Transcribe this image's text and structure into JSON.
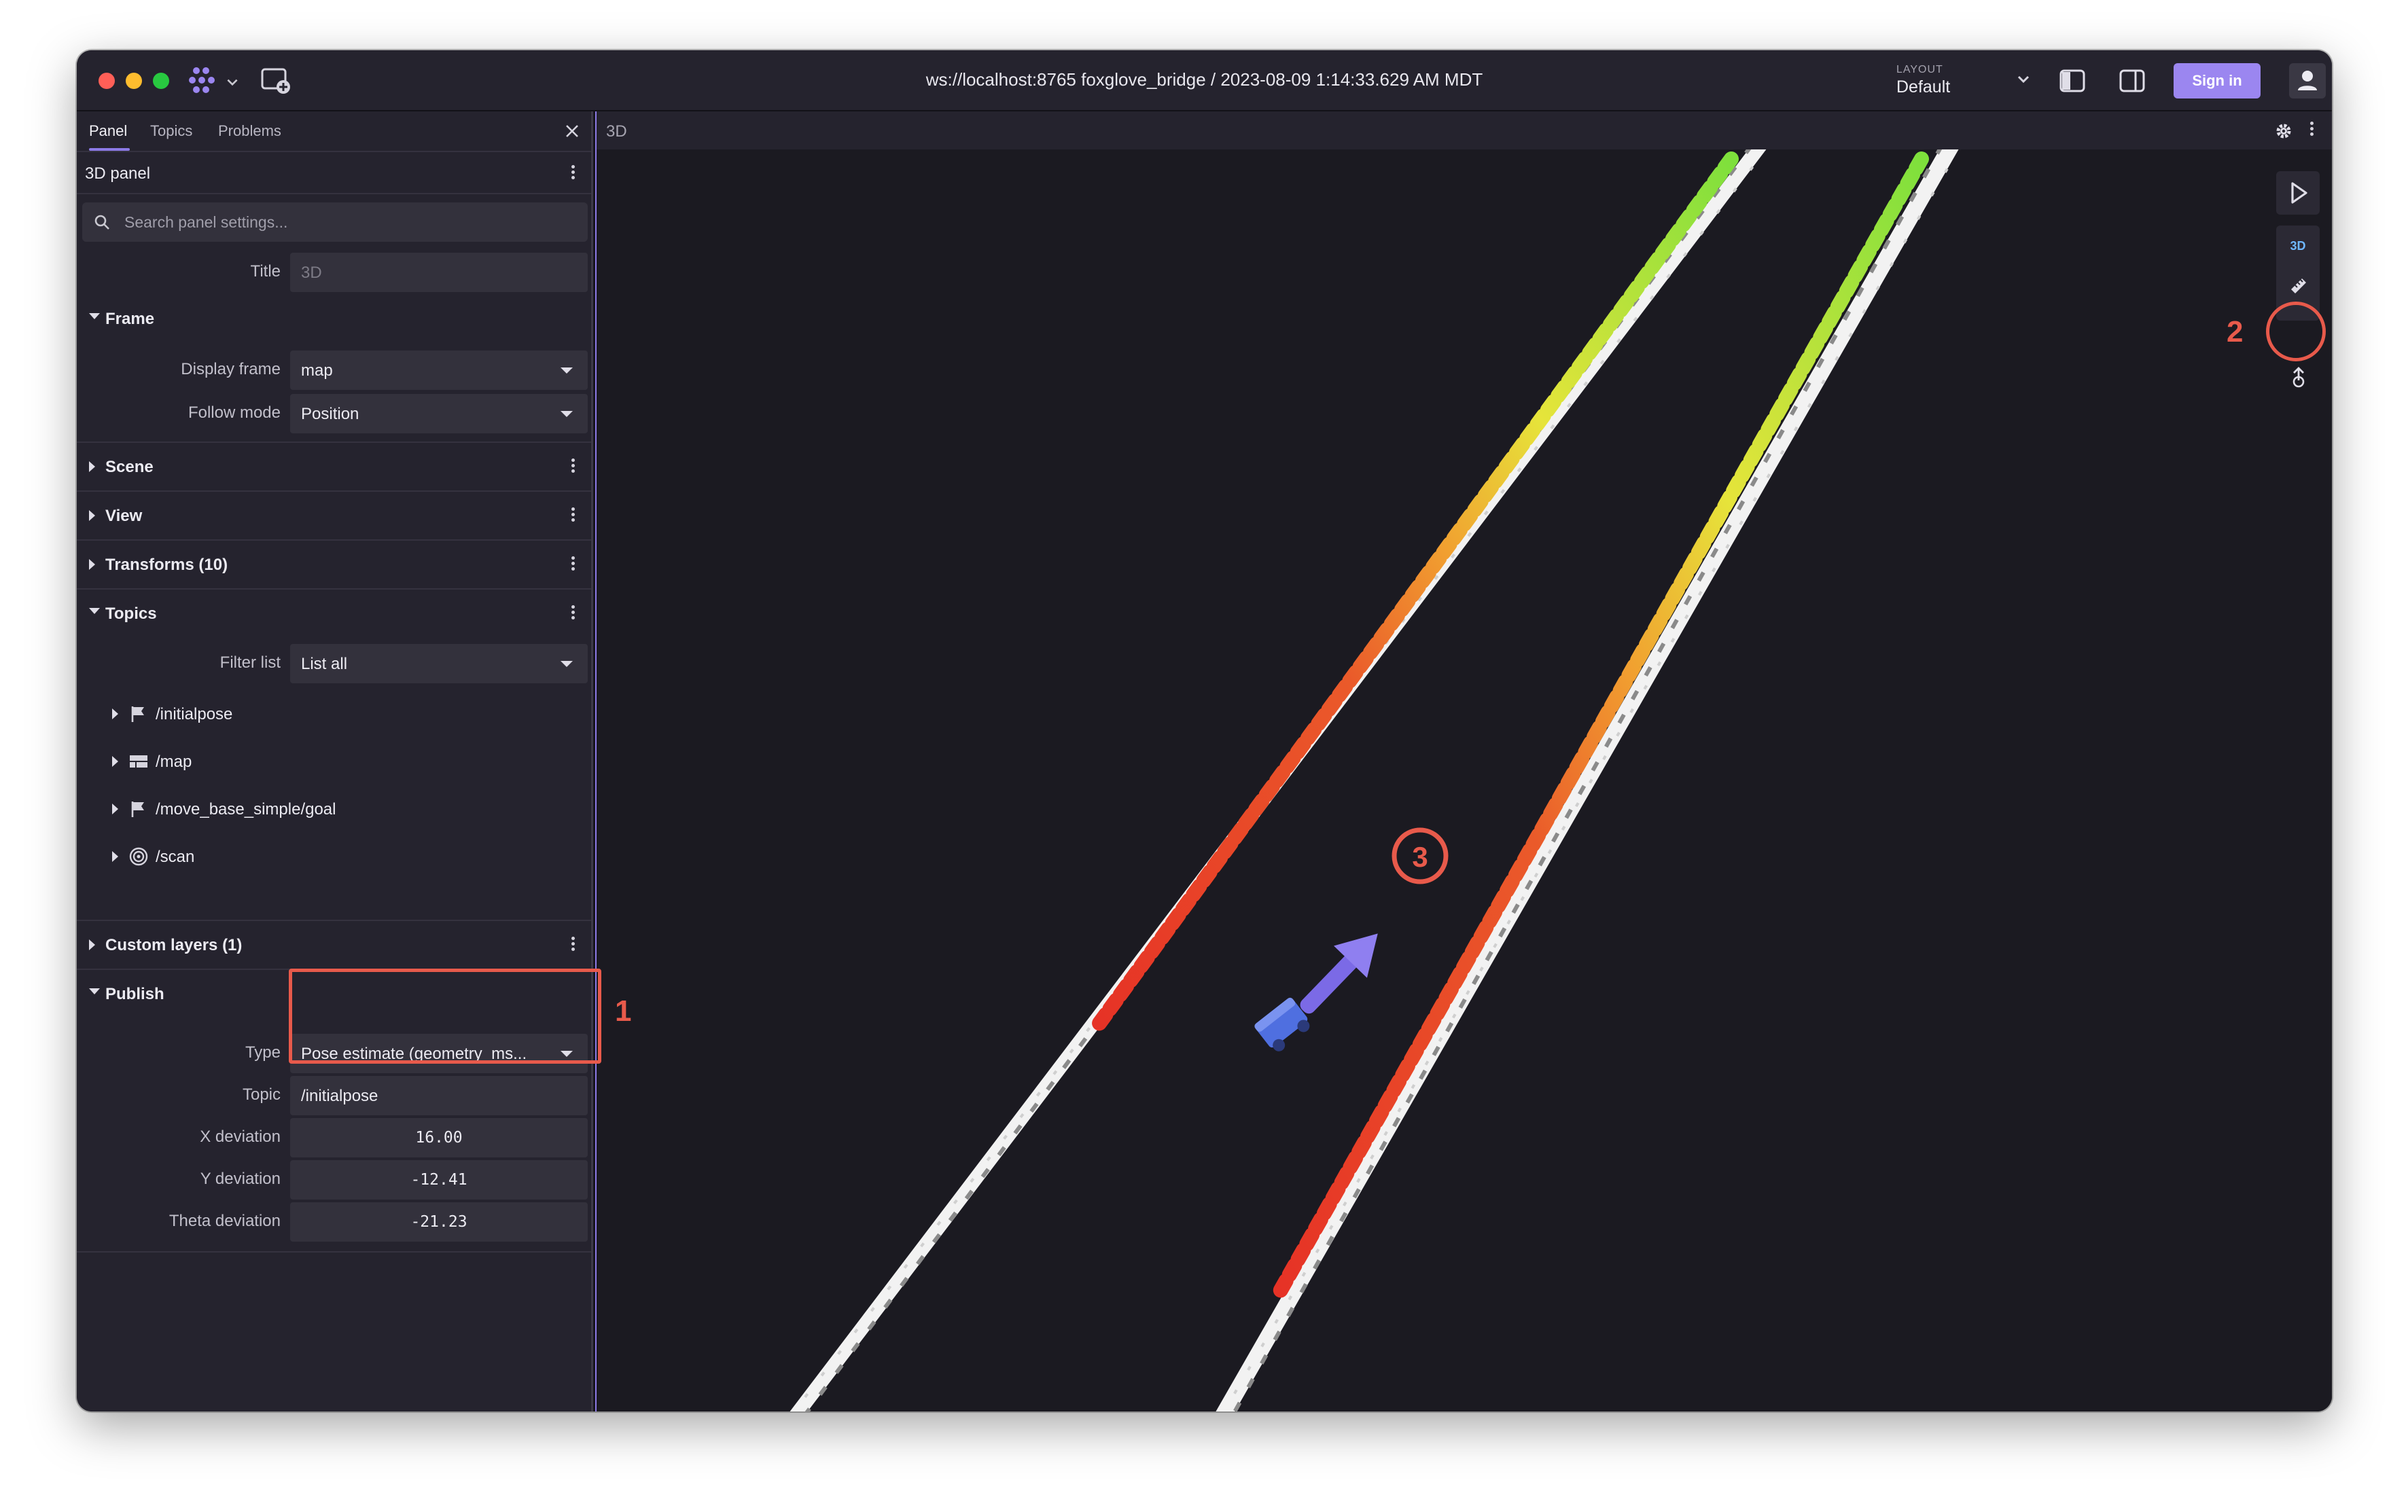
{
  "titlebar": {
    "title": "ws://localhost:8765 foxglove_bridge / 2023-08-09 1:14:33.629 AM MDT",
    "layout_caption": "LAYOUT",
    "layout_value": "Default",
    "signin_label": "Sign in"
  },
  "sidebar": {
    "tabs": [
      {
        "label": "Panel"
      },
      {
        "label": "Topics"
      },
      {
        "label": "Problems"
      }
    ],
    "panel_title": "3D panel",
    "search_placeholder": "Search panel settings...",
    "title_field": {
      "label": "Title",
      "placeholder": "3D"
    },
    "sections": {
      "frame": "Frame",
      "scene": "Scene",
      "view": "View",
      "transforms": "Transforms (10)",
      "topics": "Topics",
      "custom_layers": "Custom layers (1)",
      "publish": "Publish"
    },
    "frame": {
      "display_frame_label": "Display frame",
      "display_frame_value": "map",
      "follow_mode_label": "Follow mode",
      "follow_mode_value": "Position"
    },
    "topics": {
      "filter_label": "Filter list",
      "filter_value": "List all",
      "items": [
        {
          "name": "/initialpose",
          "icon": "flag-icon"
        },
        {
          "name": "/map",
          "icon": "grid-icon"
        },
        {
          "name": "/move_base_simple/goal",
          "icon": "flag-icon"
        },
        {
          "name": "/scan",
          "icon": "radar-icon"
        }
      ]
    },
    "publish": {
      "type_label": "Type",
      "type_value": "Pose estimate (geometry_ms...",
      "topic_label": "Topic",
      "topic_value": "/initialpose",
      "x_label": "X deviation",
      "x_value": "16.00",
      "y_label": "Y deviation",
      "y_value": "-12.41",
      "theta_label": "Theta deviation",
      "theta_value": "-21.23"
    }
  },
  "viewport": {
    "title": "3D",
    "toggle_3d_label": "3D"
  },
  "annotations": {
    "n1": "1",
    "n2": "2",
    "n3": "3"
  },
  "colors": {
    "accent": "#8c7ae6",
    "annotation": "#e85a4b",
    "robot": "#4f6fe0",
    "pose_arrow": "#7b6ae6"
  }
}
